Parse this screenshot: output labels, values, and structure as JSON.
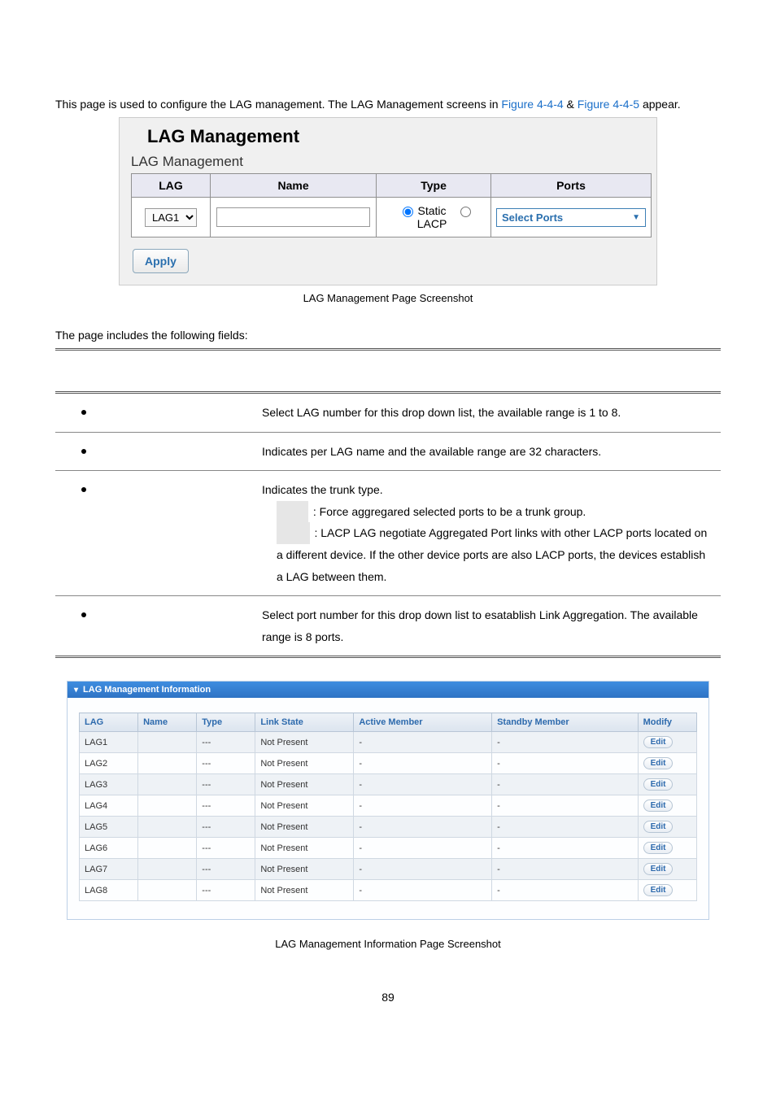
{
  "intro": {
    "prefix": "This page is used to configure the LAG management. The LAG Management screens in ",
    "link1": "Figure 4-4-4",
    "mid": " & ",
    "link2": "Figure 4-4-5",
    "suffix": " appear."
  },
  "shot1": {
    "title": "LAG Management",
    "subtitle": "LAG Management",
    "headers": {
      "lag": "LAG",
      "name": "Name",
      "type": "Type",
      "ports": "Ports"
    },
    "lag_select": "LAG1",
    "type_static": "Static",
    "type_lacp": "LACP",
    "select_ports": "Select Ports",
    "apply": "Apply"
  },
  "caption1": "LAG Management Page Screenshot",
  "fields_intro": "The page includes the following fields:",
  "desc": [
    {
      "text": "Select LAG number for this drop down list, the available range is 1 to 8."
    },
    {
      "text": "Indicates per LAG name and the available range are 32 characters."
    },
    {
      "line1": "Indicates the trunk type.",
      "opt1_text": ": Force aggregared selected ports to be a trunk group.",
      "opt2_text": ": LACP LAG negotiate Aggregated Port links with other LACP ports located on a different device. If the other device ports are also LACP ports, the devices establish a LAG between them."
    },
    {
      "text": "Select port number for this drop down list to esatablish Link Aggregation. The available range is 8 ports."
    }
  ],
  "shot2": {
    "panel_title": "LAG Management Information",
    "headers": {
      "lag": "LAG",
      "name": "Name",
      "type": "Type",
      "link": "Link State",
      "active": "Active Member",
      "standby": "Standby Member",
      "modify": "Modify"
    },
    "edit": "Edit",
    "rows": [
      {
        "lag": "LAG1",
        "name": "",
        "type": "---",
        "link": "Not Present",
        "active": "-",
        "standby": "-"
      },
      {
        "lag": "LAG2",
        "name": "",
        "type": "---",
        "link": "Not Present",
        "active": "-",
        "standby": "-"
      },
      {
        "lag": "LAG3",
        "name": "",
        "type": "---",
        "link": "Not Present",
        "active": "-",
        "standby": "-"
      },
      {
        "lag": "LAG4",
        "name": "",
        "type": "---",
        "link": "Not Present",
        "active": "-",
        "standby": "-"
      },
      {
        "lag": "LAG5",
        "name": "",
        "type": "---",
        "link": "Not Present",
        "active": "-",
        "standby": "-"
      },
      {
        "lag": "LAG6",
        "name": "",
        "type": "---",
        "link": "Not Present",
        "active": "-",
        "standby": "-"
      },
      {
        "lag": "LAG7",
        "name": "",
        "type": "---",
        "link": "Not Present",
        "active": "-",
        "standby": "-"
      },
      {
        "lag": "LAG8",
        "name": "",
        "type": "---",
        "link": "Not Present",
        "active": "-",
        "standby": "-"
      }
    ]
  },
  "caption2": "LAG Management Information Page Screenshot",
  "page_number": "89"
}
